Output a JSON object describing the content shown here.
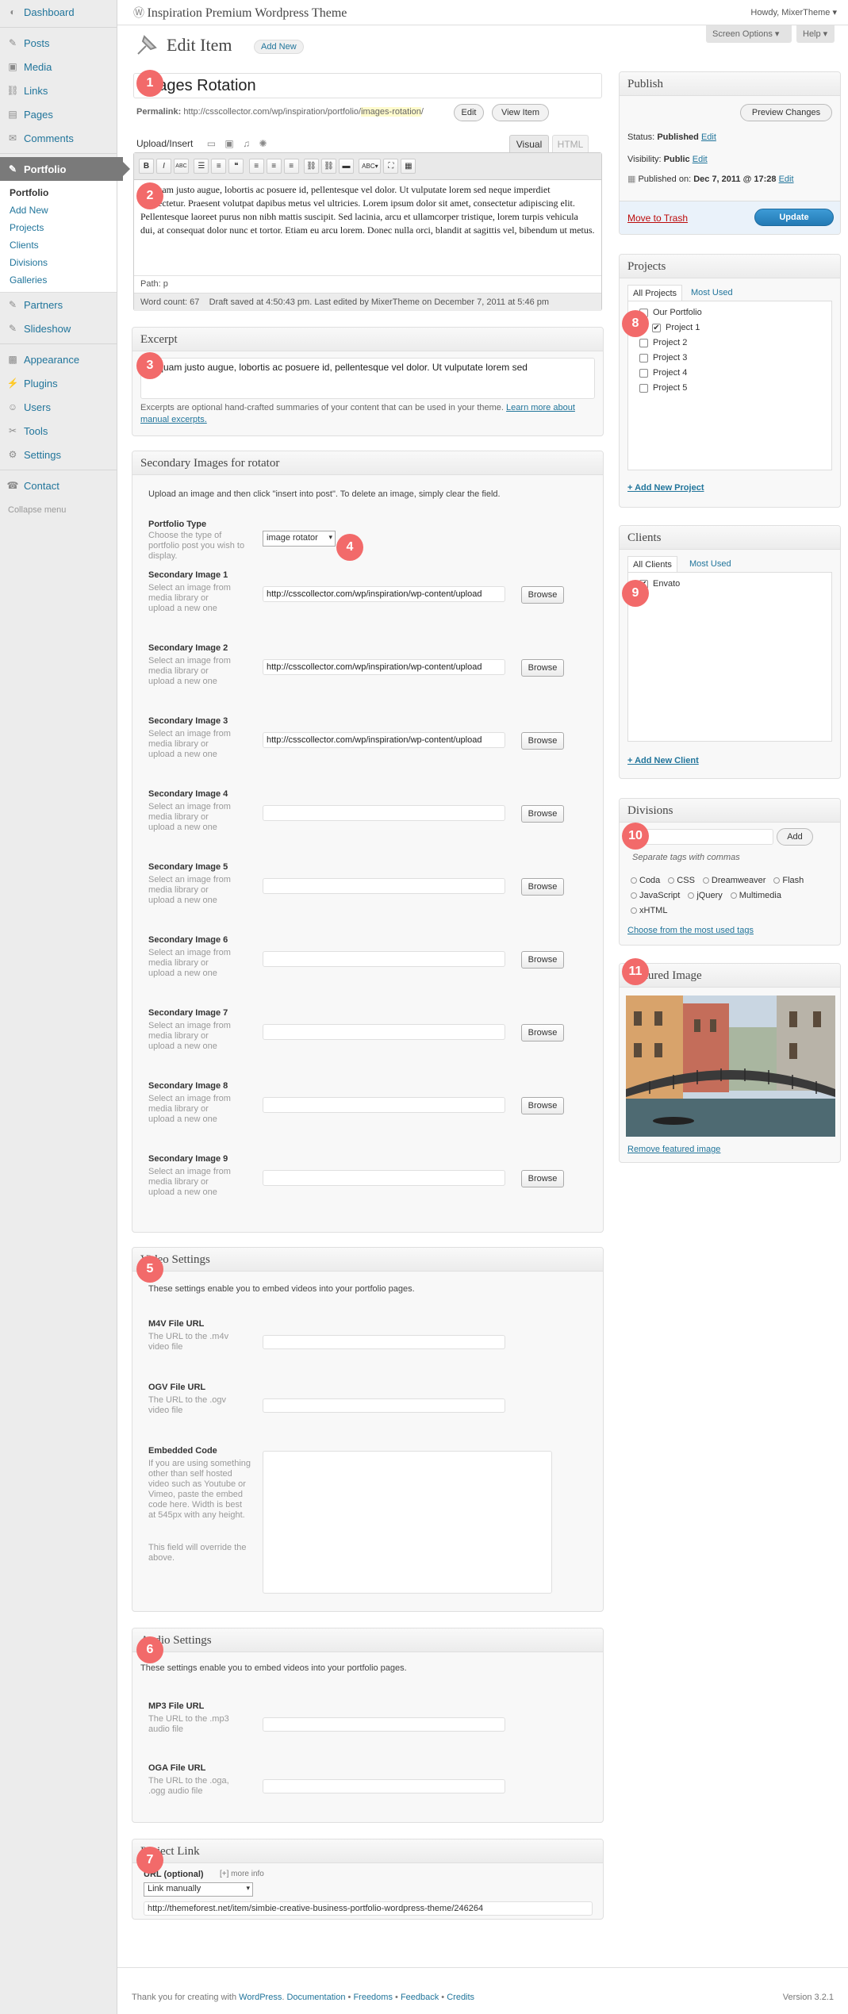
{
  "sidebar": {
    "items": [
      {
        "label": "Dashboard",
        "icon": "dashboard-icon"
      },
      {
        "label": "Posts",
        "icon": "pin-icon"
      },
      {
        "label": "Media",
        "icon": "media-icon"
      },
      {
        "label": "Links",
        "icon": "link-icon"
      },
      {
        "label": "Pages",
        "icon": "page-icon"
      },
      {
        "label": "Comments",
        "icon": "comment-icon"
      },
      {
        "label": "Portfolio",
        "icon": "pin-icon"
      }
    ],
    "portfolio_sub": [
      "Portfolio",
      "Add New",
      "Projects",
      "Clients",
      "Divisions",
      "Galleries"
    ],
    "items2": [
      {
        "label": "Partners",
        "icon": "pin-icon"
      },
      {
        "label": "Slideshow",
        "icon": "pin-icon"
      },
      {
        "label": "Appearance",
        "icon": "appearance-icon"
      },
      {
        "label": "Plugins",
        "icon": "plugin-icon"
      },
      {
        "label": "Users",
        "icon": "users-icon"
      },
      {
        "label": "Tools",
        "icon": "tools-icon"
      },
      {
        "label": "Settings",
        "icon": "settings-icon"
      },
      {
        "label": "Contact",
        "icon": "contact-icon"
      }
    ],
    "collapse": "Collapse menu"
  },
  "topbar": {
    "site": "Inspiration Premium Wordpress Theme",
    "howdy": "Howdy, MixerTheme ▾",
    "screen_options": "Screen Options ▾",
    "help": "Help ▾"
  },
  "header": {
    "title": "Edit Item",
    "add_new": "Add New"
  },
  "post": {
    "title": "Images Rotation",
    "permalink_label": "Permalink:",
    "permalink_base": "http://csscollector.com/wp/inspiration/portfolio/",
    "permalink_slug": "images-rotation",
    "permalink_end": "/",
    "edit": "Edit",
    "view": "View Item",
    "upload": "Upload/Insert",
    "visual": "Visual",
    "html": "HTML",
    "content": "Aliquam justo augue, lobortis ac posuere id, pellentesque vel dolor. Ut vulputate lorem sed neque imperdiet consectetur. Praesent volutpat dapibus metus vel ultricies. Lorem ipsum dolor sit amet, consectetur adipiscing elit. Pellentesque laoreet purus non nibh mattis suscipit. Sed lacinia, arcu et ullamcorper tristique, lorem turpis vehicula dui, at consequat dolor nunc et tortor. Etiam eu arcu lorem. Donec nulla orci, blandit at sagittis vel, bibendum ut metus.",
    "path": "Path: p",
    "wordcount": "Word count: 67",
    "draft": "Draft saved at 4:50:43 pm. Last edited by MixerTheme on December 7, 2011 at 5:46 pm"
  },
  "excerpt": {
    "title": "Excerpt",
    "value": "Aliquam justo augue, lobortis ac posuere id, pellentesque vel dolor. Ut vulputate lorem sed",
    "help": "Excerpts are optional hand-crafted summaries of your content that can be used in your theme.",
    "help_link": "Learn more about manual excerpts."
  },
  "secondary": {
    "title": "Secondary Images for rotator",
    "intro": "Upload an image and then click \"insert into post\". To delete an image, simply clear the field.",
    "type_label": "Portfolio Type",
    "type_hint": "Choose the type of portfolio post you wish to display.",
    "type_value": "image rotator",
    "img_hint": "Select an image from media library or upload a new one",
    "browse": "Browse",
    "images": [
      {
        "label": "Secondary Image 1",
        "value": "http://csscollector.com/wp/inspiration/wp-content/upload"
      },
      {
        "label": "Secondary Image 2",
        "value": "http://csscollector.com/wp/inspiration/wp-content/upload"
      },
      {
        "label": "Secondary Image 3",
        "value": "http://csscollector.com/wp/inspiration/wp-content/upload"
      },
      {
        "label": "Secondary Image 4",
        "value": ""
      },
      {
        "label": "Secondary Image 5",
        "value": ""
      },
      {
        "label": "Secondary Image 6",
        "value": ""
      },
      {
        "label": "Secondary Image 7",
        "value": ""
      },
      {
        "label": "Secondary Image 8",
        "value": ""
      },
      {
        "label": "Secondary Image 9",
        "value": ""
      }
    ]
  },
  "video": {
    "title": "Video Settings",
    "intro": "These settings enable you to embed videos into your portfolio pages.",
    "m4v_label": "M4V File URL",
    "m4v_hint": "The URL to the .m4v video file",
    "ogv_label": "OGV File URL",
    "ogv_hint": "The URL to the .ogv video file",
    "embed_label": "Embedded Code",
    "embed_hint": "If you are using something other than self hosted video such as Youtube or Vimeo, paste the embed code here. Width is best at 545px with any height.",
    "embed_hint2": "This field will override the above."
  },
  "audio": {
    "title": "Audio Settings",
    "intro": "These settings enable you to embed videos into your portfolio pages.",
    "mp3_label": "MP3 File URL",
    "mp3_hint": "The URL to the .mp3 audio file",
    "oga_label": "OGA File URL",
    "oga_hint": "The URL to the .oga, .ogg audio file"
  },
  "project_link": {
    "title": "Project Link",
    "url_label": "URL (optional)",
    "more": "[+] more info",
    "select": "Link manually",
    "url": "http://themeforest.net/item/simbie-creative-business-portfolio-wordpress-theme/246264"
  },
  "publish": {
    "title": "Publish",
    "preview": "Preview Changes",
    "status_label": "Status:",
    "status": "Published",
    "visibility_label": "Visibility:",
    "visibility": "Public",
    "published_label": "Published on:",
    "published": "Dec 7, 2011 @ 17:28",
    "edit": "Edit",
    "trash": "Move to Trash",
    "update": "Update"
  },
  "projects": {
    "title": "Projects",
    "tab_all": "All Projects",
    "tab_used": "Most Used",
    "items": [
      {
        "label": "Our Portfolio",
        "checked": false,
        "indent": false
      },
      {
        "label": "Project 1",
        "checked": true,
        "indent": true
      },
      {
        "label": "Project 2",
        "checked": false,
        "indent": false
      },
      {
        "label": "Project 3",
        "checked": false,
        "indent": false
      },
      {
        "label": "Project 4",
        "checked": false,
        "indent": false
      },
      {
        "label": "Project 5",
        "checked": false,
        "indent": false
      }
    ],
    "add": "+ Add New Project"
  },
  "clients": {
    "title": "Clients",
    "tab_all": "All Clients",
    "tab_used": "Most Used",
    "items": [
      {
        "label": "Envato",
        "checked": true
      }
    ],
    "add": "+ Add New Client"
  },
  "divisions": {
    "title": "Divisions",
    "add": "Add",
    "hint": "Separate tags with commas",
    "tags": [
      "Coda",
      "CSS",
      "Dreamweaver",
      "Flash",
      "JavaScript",
      "jQuery",
      "Multimedia",
      "xHTML"
    ],
    "choose": "Choose from the most used tags"
  },
  "featured": {
    "title": "Featured Image",
    "remove": "Remove featured image"
  },
  "footer": {
    "thanks": "Thank you for creating with",
    "wp": "WordPress",
    "links": [
      "Documentation",
      "Freedoms",
      "Feedback",
      "Credits"
    ],
    "version": "Version 3.2.1"
  },
  "badges": [
    "1",
    "2",
    "3",
    "4",
    "5",
    "6",
    "7",
    "8",
    "9",
    "10",
    "11"
  ],
  "colors": {
    "link": "#21759b",
    "badge": "#f26a6a",
    "update": "#2e8bc7",
    "trash": "#bc0b0b"
  }
}
